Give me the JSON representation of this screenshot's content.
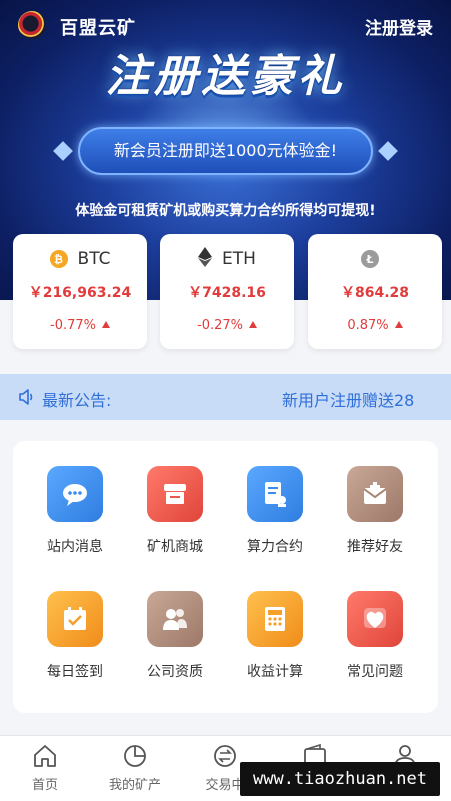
{
  "app": {
    "title": "百盟云矿",
    "login": "注册登录"
  },
  "banner": {
    "title": "注册送豪礼",
    "promo": "新会员注册即送1000元体验金!",
    "subtitle": "体验金可租赁矿机或购买算力合约所得均可提现!"
  },
  "coins": [
    {
      "name": "BTC",
      "icon": "bitcoin-icon",
      "price": "￥216,963.24",
      "change": "-0.77%",
      "color": "#f5a623"
    },
    {
      "name": "ETH",
      "icon": "ethereum-icon",
      "price": "￥7428.16",
      "change": "-0.27%",
      "color": "#333333"
    },
    {
      "name": "",
      "icon": "litecoin-icon",
      "price": "￥864.28",
      "change": "0.87%",
      "color": "#9b9b9b"
    }
  ],
  "notice": {
    "label": "最新公告:",
    "text": "新用户注册赠送28"
  },
  "menu": [
    {
      "label": "站内消息",
      "icon": "message-icon"
    },
    {
      "label": "矿机商城",
      "icon": "shop-icon"
    },
    {
      "label": "算力合约",
      "icon": "contract-icon"
    },
    {
      "label": "推荐好友",
      "icon": "invite-icon"
    },
    {
      "label": "每日签到",
      "icon": "checkin-icon"
    },
    {
      "label": "公司资质",
      "icon": "company-icon"
    },
    {
      "label": "收益计算",
      "icon": "calculator-icon"
    },
    {
      "label": "常见问题",
      "icon": "faq-icon"
    }
  ],
  "tabs": [
    {
      "label": "首页",
      "icon": "home-icon"
    },
    {
      "label": "我的矿产",
      "icon": "pie-chart-icon"
    },
    {
      "label": "交易中",
      "icon": "exchange-icon"
    },
    {
      "label": "",
      "icon": "wallet-icon"
    },
    {
      "label": "",
      "icon": "user-icon"
    }
  ],
  "watermark": "www.tiaozhuan.net",
  "colors": {
    "accent": "#2f6fd8",
    "price_red": "#e23b3b",
    "hero_blue": "#1c3e9c"
  }
}
